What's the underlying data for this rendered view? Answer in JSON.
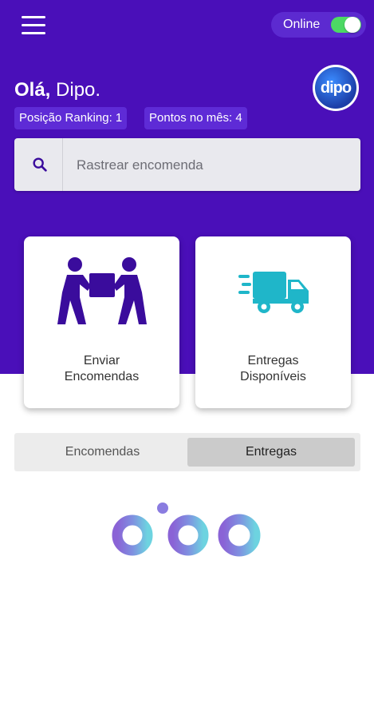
{
  "header": {
    "online_label": "Online",
    "online_toggle_on": true,
    "greeting_prefix": "Olá,",
    "user_name": "Dipo.",
    "avatar_text": "dipo",
    "ranking_chip": "Posição Ranking: 1",
    "points_chip": "Pontos no mês: 4"
  },
  "search": {
    "placeholder": "Rastrear encomenda"
  },
  "actions": [
    {
      "line1": "Enviar",
      "line2": "Encomendas",
      "icon": "people-carrying-box-icon"
    },
    {
      "line1": "Entregas",
      "line2": "Disponíveis",
      "icon": "fast-delivery-truck-icon"
    }
  ],
  "tabs": {
    "items": [
      "Encomendas",
      "Entregas"
    ],
    "selected": "Entregas"
  },
  "brand": {
    "logo_text": "dipo"
  },
  "colors": {
    "primary": "#4a0fb9",
    "chip": "#5e2bd6",
    "toggle_on": "#4cd964",
    "icon_purple": "#3a0c9c",
    "icon_teal": "#1fb6c9"
  }
}
